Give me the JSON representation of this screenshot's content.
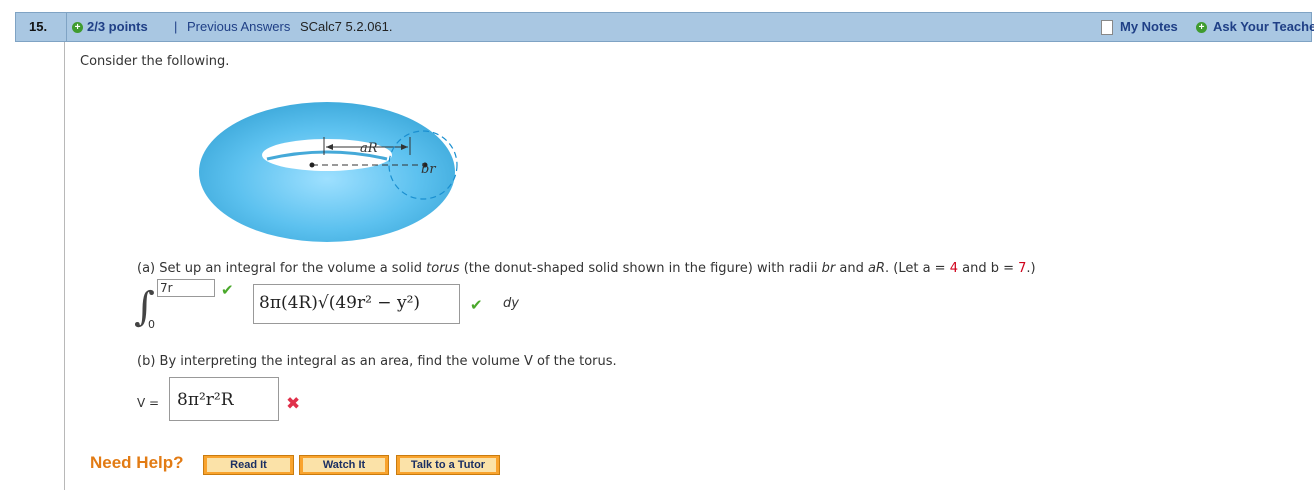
{
  "header": {
    "question_number": "15.",
    "points": "2/3 points",
    "separator": "|",
    "previous_answers": "Previous Answers",
    "problem_id": "SCalc7 5.2.061.",
    "my_notes": "My Notes",
    "ask_teacher": "Ask Your Teacher"
  },
  "intro": "Consider the following.",
  "figure": {
    "label_aR": "aR",
    "label_br": "br"
  },
  "part_a": {
    "prompt_pre": "(a) Set up an integral for the volume a solid ",
    "prompt_torus": "torus",
    "prompt_mid": " (the donut-shaped solid shown in the figure) with radii ",
    "prompt_br": "br",
    "prompt_and": " and ",
    "prompt_aR": "aR",
    "prompt_let": ". (Let a = ",
    "a_value": "4",
    "prompt_andb": " and b = ",
    "b_value": "7",
    "prompt_end": ".)",
    "upper_limit": "7r",
    "lower_limit": "0",
    "integrand": "8π(4R)√(49r² − y²)",
    "differential": "dy",
    "upper_status": "correct",
    "integrand_status": "correct"
  },
  "part_b": {
    "prompt": "(b) By interpreting the integral as an area, find the volume V of the torus.",
    "v_label": "V =",
    "answer": "8π²r²R",
    "status": "incorrect"
  },
  "help": {
    "label": "Need Help?",
    "buttons": [
      "Read It",
      "Watch It",
      "Talk to a Tutor"
    ]
  },
  "colors": {
    "header_bg": "#a9c7e2",
    "torus": "#5bbcea",
    "correct": "#4aa82b",
    "incorrect": "#e0304a",
    "help_orange": "#e27b14"
  }
}
